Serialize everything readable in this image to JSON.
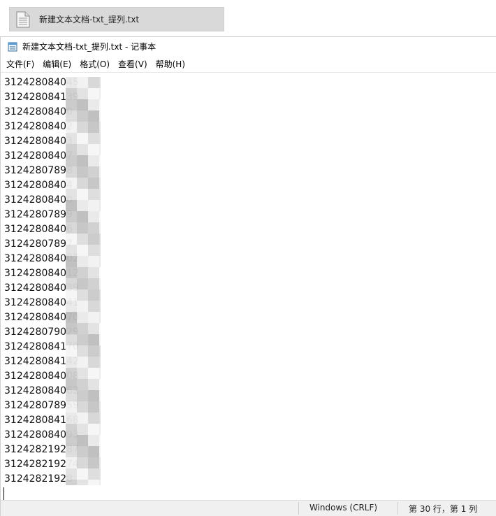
{
  "file_tile": {
    "name": "新建文本文档-txt_提列.txt",
    "icon": "document-icon"
  },
  "window": {
    "title": "新建文本文档-txt_提列.txt - 记事本",
    "icon": "notepad-icon"
  },
  "menu": [
    {
      "label": "文件(F)"
    },
    {
      "label": "编辑(E)"
    },
    {
      "label": "格式(O)"
    },
    {
      "label": "查看(V)"
    },
    {
      "label": "帮助(H)"
    }
  ],
  "editor": {
    "lines": [
      "312428084045",
      "312428084139",
      "31242808400",
      "31242808402",
      "31242808403",
      "31242808407",
      "31242807898",
      "31242808404",
      "31242808400",
      "31242807899",
      "31242808406",
      "31242807897",
      "312428084002",
      "312428084012",
      "312428084039",
      "312428084041",
      "312428084070",
      "312428079029",
      "312428084170",
      "312428084142",
      "312428084008",
      "312428084062",
      "312428078959",
      "312428084168",
      "312428084093",
      "312428219287",
      "312428219274",
      "31242821928"
    ],
    "redaction": "pixelated"
  },
  "statusbar": {
    "encoding": "Windows (CRLF)",
    "position": "第 30 行，第 1 列"
  }
}
